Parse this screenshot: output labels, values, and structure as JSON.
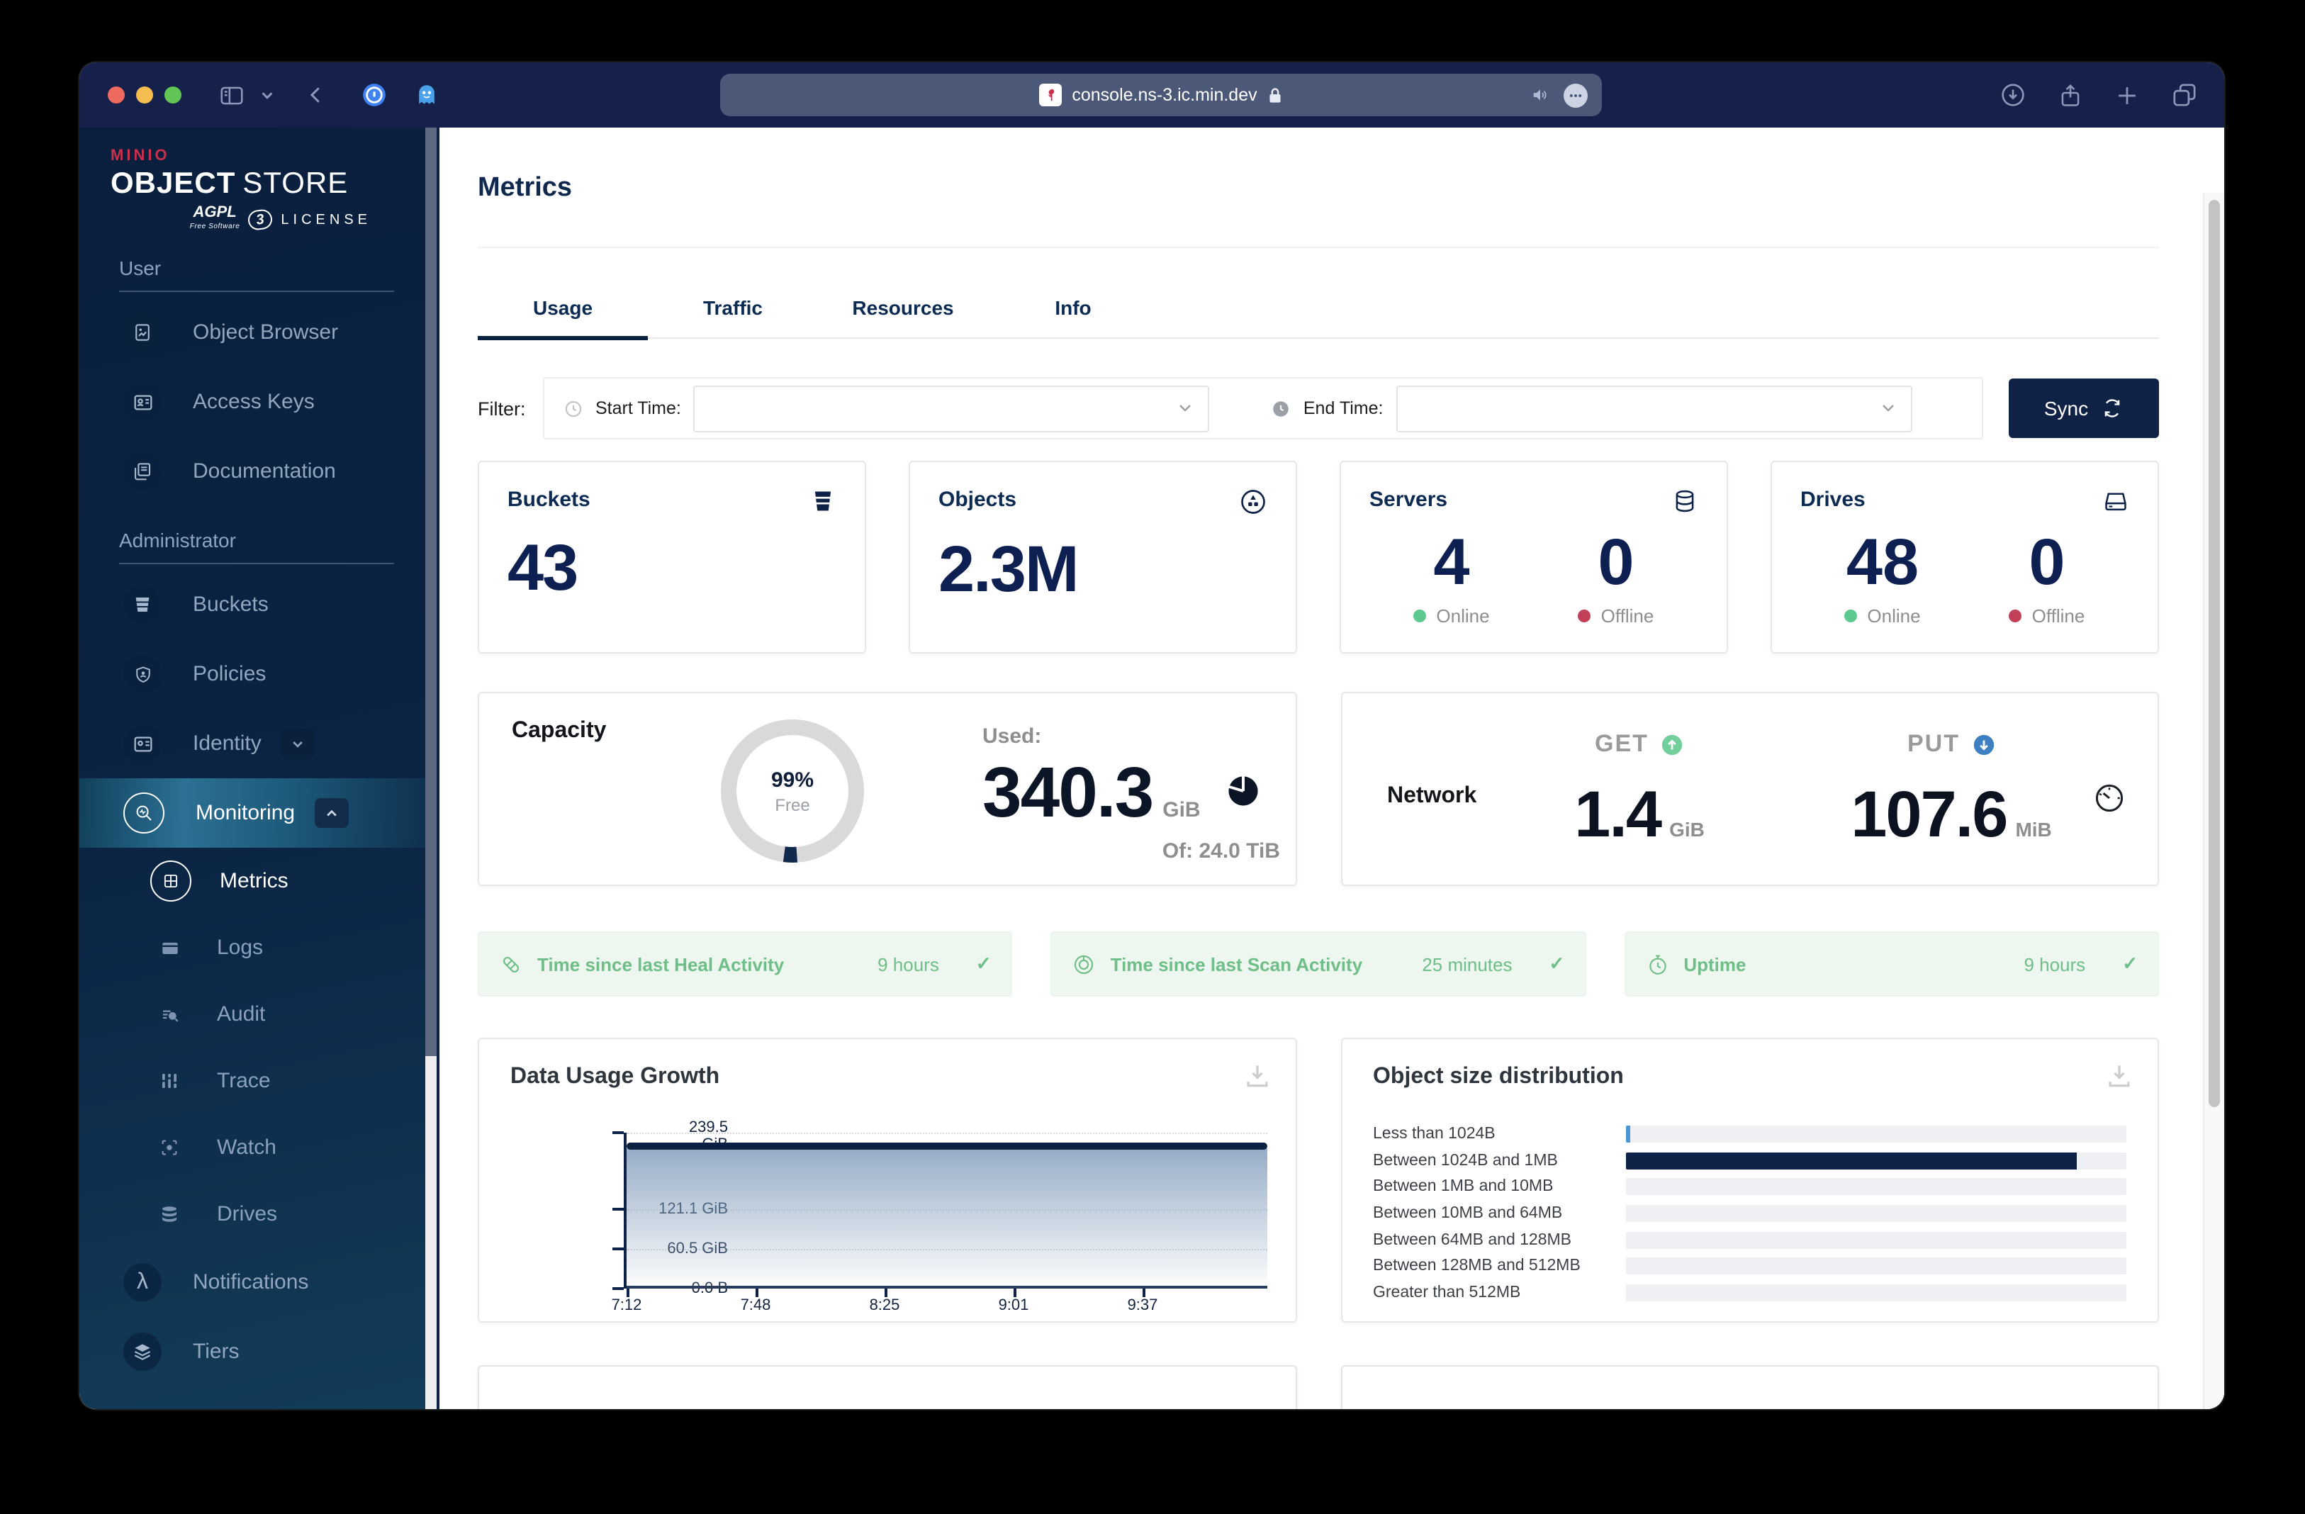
{
  "browser": {
    "url": "console.ns-3.ic.min.dev"
  },
  "sidebar": {
    "logo": {
      "brand": "MINIO",
      "title_bold": "OBJECT",
      "title_light": "STORE",
      "badge": "AGPL",
      "badge_sub": "Free Software",
      "badge_version": "3",
      "license": "LICENSE"
    },
    "sections": {
      "user": "User",
      "admin": "Administrator"
    },
    "items_user": [
      {
        "label": "Object Browser"
      },
      {
        "label": "Access Keys"
      },
      {
        "label": "Documentation"
      }
    ],
    "items_admin": [
      {
        "label": "Buckets"
      },
      {
        "label": "Policies"
      },
      {
        "label": "Identity"
      }
    ],
    "monitoring": {
      "label": "Monitoring"
    },
    "monitoring_children": [
      {
        "label": "Metrics"
      },
      {
        "label": "Logs"
      },
      {
        "label": "Audit"
      },
      {
        "label": "Trace"
      },
      {
        "label": "Watch"
      },
      {
        "label": "Drives"
      }
    ],
    "items_admin_bottom": [
      {
        "label": "Notifications"
      },
      {
        "label": "Tiers"
      }
    ]
  },
  "header": {
    "title": "Metrics"
  },
  "tabs": [
    {
      "label": "Usage"
    },
    {
      "label": "Traffic"
    },
    {
      "label": "Resources"
    },
    {
      "label": "Info"
    }
  ],
  "filter": {
    "label": "Filter:",
    "start_label": "Start Time:",
    "end_label": "End Time:",
    "sync_label": "Sync"
  },
  "stats": {
    "buckets": {
      "label": "Buckets",
      "value": "43"
    },
    "objects": {
      "label": "Objects",
      "value": "2.3M"
    },
    "servers": {
      "label": "Servers",
      "online": "4",
      "offline": "0",
      "online_label": "Online",
      "offline_label": "Offline"
    },
    "drives": {
      "label": "Drives",
      "online": "48",
      "offline": "0",
      "online_label": "Online",
      "offline_label": "Offline"
    }
  },
  "capacity": {
    "title": "Capacity",
    "free_pct": "99%",
    "free_label": "Free",
    "used_label": "Used:",
    "used_value": "340.3",
    "used_unit": "GiB",
    "total": "Of: 24.0 TiB"
  },
  "network": {
    "title": "Network",
    "get_label": "GET",
    "get_value": "1.4",
    "get_unit": "GiB",
    "put_label": "PUT",
    "put_value": "107.6",
    "put_unit": "MiB"
  },
  "status_bars": [
    {
      "label": "Time since last Heal Activity",
      "value": "9 hours"
    },
    {
      "label": "Time since last Scan Activity",
      "value": "25 minutes"
    },
    {
      "label": "Uptime",
      "value": "9 hours"
    }
  ],
  "colors": {
    "accent_navy": "#0e2247",
    "green": "#5cc98e",
    "red": "#c2405a",
    "status_green": "#6fbe88",
    "bar_highlight": "#4a97d4"
  },
  "chart_data": [
    {
      "type": "area",
      "title": "Data Usage Growth",
      "x": [
        "7:12",
        "7:48",
        "8:25",
        "9:01",
        "9:37"
      ],
      "series": [
        {
          "name": "Data Usage",
          "values": [
            219,
            219,
            219,
            219,
            219,
            219
          ]
        }
      ],
      "y_ticks": [
        {
          "value": 239.5,
          "label": "239.5 GiB"
        },
        {
          "value": 121.1,
          "label": "121.1 GiB"
        },
        {
          "value": 60.5,
          "label": "60.5 GiB"
        },
        {
          "value": 0,
          "label": "0.0 B"
        }
      ],
      "ylim": [
        0,
        239.5
      ],
      "unit": "GiB",
      "grid": "dotted-horizontal",
      "line_color": "#0c2044"
    },
    {
      "type": "bar",
      "orientation": "horizontal",
      "title": "Object size distribution",
      "categories": [
        "Less than 1024B",
        "Between 1024B and 1MB",
        "Between 1MB and 10MB",
        "Between 10MB and 64MB",
        "Between 64MB and 128MB",
        "Between 128MB and 512MB",
        "Greater than 512MB"
      ],
      "values_fraction": [
        0.008,
        0.9,
        0,
        0,
        0,
        0,
        0
      ],
      "bar_colors": [
        "#4a97d4",
        "#0e2247",
        "#0e2247",
        "#0e2247",
        "#0e2247",
        "#0e2247",
        "#0e2247"
      ],
      "track_color": "#eef0f3",
      "legend": false
    }
  ]
}
